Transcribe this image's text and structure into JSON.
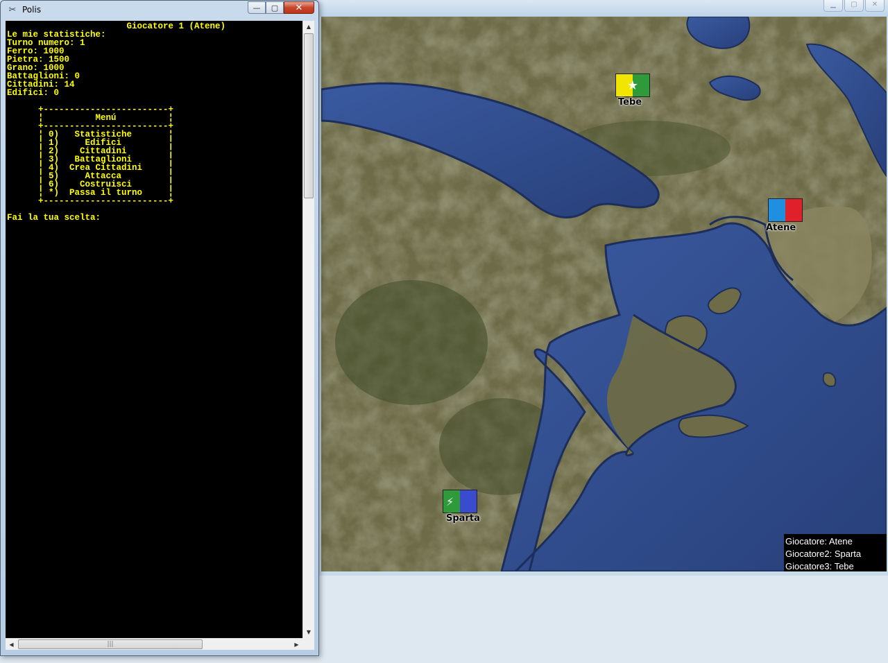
{
  "console": {
    "window_title": "Polis",
    "controls": {
      "minimize": "—",
      "maximize": "▢",
      "close": "✕"
    },
    "header": "Giocatore 1 (Atene)",
    "stats_title": "Le mie statistiche:",
    "stats": [
      "Turno numero: 1",
      "Ferro: 1000",
      "Pietra: 1500",
      "Grano: 1000",
      "Battaglioni: 0",
      "Cittadini: 14",
      "Edifici: 0"
    ],
    "menu_title": "Menú",
    "menu_items": [
      {
        "key": "0)",
        "label": "Statistiche"
      },
      {
        "key": "1)",
        "label": "Edifici"
      },
      {
        "key": "2)",
        "label": "Cittadini"
      },
      {
        "key": "3)",
        "label": "Battaglioni"
      },
      {
        "key": "4)",
        "label": "Crea Cittadini"
      },
      {
        "key": "5)",
        "label": "Attacca"
      },
      {
        "key": "6)",
        "label": "Costruisci"
      },
      {
        "key": "*)",
        "label": "Passa il turno"
      }
    ],
    "prompt": "Fai la tua scelta:"
  },
  "map": {
    "cities": [
      {
        "name": "Tebe",
        "flag_colors": [
          "#f2e600",
          "#2e9a3a"
        ],
        "emblem": "star-icon"
      },
      {
        "name": "Atene",
        "flag_colors": [
          "#1f8fe0",
          "#e0202a"
        ],
        "emblem": ""
      },
      {
        "name": "Sparta",
        "flag_colors": [
          "#2e9a3a",
          "#3a4bd0"
        ],
        "emblem": "lightning-icon"
      }
    ],
    "players": [
      "Giocatore: Atene",
      "Giocatore2: Sparta",
      "Giocatore3: Tebe"
    ]
  },
  "colors": {
    "console_text": "#ffff00",
    "sea": "#2e4a8a",
    "land": "#6b6b44"
  }
}
